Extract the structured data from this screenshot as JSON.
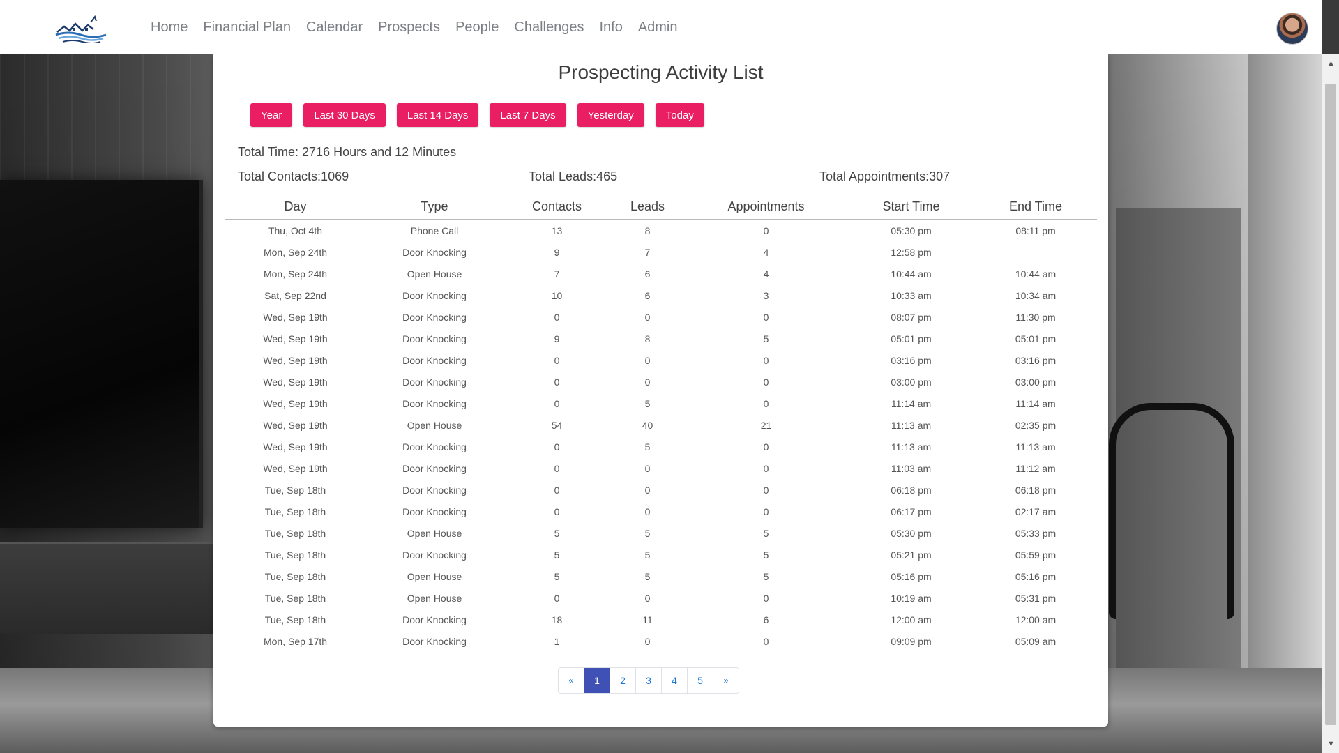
{
  "nav": {
    "links": [
      "Home",
      "Financial Plan",
      "Calendar",
      "Prospects",
      "People",
      "Challenges",
      "Info",
      "Admin"
    ]
  },
  "page": {
    "title": "Prospecting Activity List",
    "filters": [
      "Year",
      "Last 30 Days",
      "Last 14 Days",
      "Last 7 Days",
      "Yesterday",
      "Today"
    ],
    "total_time": "Total Time: 2716 Hours and 12 Minutes",
    "total_contacts": "Total Contacts:1069",
    "total_leads": "Total Leads:465",
    "total_appointments": "Total Appointments:307"
  },
  "table": {
    "columns": [
      "Day",
      "Type",
      "Contacts",
      "Leads",
      "Appointments",
      "Start Time",
      "End Time"
    ],
    "rows": [
      [
        "Thu, Oct 4th",
        "Phone Call",
        "13",
        "8",
        "0",
        "05:30 pm",
        "08:11 pm"
      ],
      [
        "Mon, Sep 24th",
        "Door Knocking",
        "9",
        "7",
        "4",
        "12:58 pm",
        ""
      ],
      [
        "Mon, Sep 24th",
        "Open House",
        "7",
        "6",
        "4",
        "10:44 am",
        "10:44 am"
      ],
      [
        "Sat, Sep 22nd",
        "Door Knocking",
        "10",
        "6",
        "3",
        "10:33 am",
        "10:34 am"
      ],
      [
        "Wed, Sep 19th",
        "Door Knocking",
        "0",
        "0",
        "0",
        "08:07 pm",
        "11:30 pm"
      ],
      [
        "Wed, Sep 19th",
        "Door Knocking",
        "9",
        "8",
        "5",
        "05:01 pm",
        "05:01 pm"
      ],
      [
        "Wed, Sep 19th",
        "Door Knocking",
        "0",
        "0",
        "0",
        "03:16 pm",
        "03:16 pm"
      ],
      [
        "Wed, Sep 19th",
        "Door Knocking",
        "0",
        "0",
        "0",
        "03:00 pm",
        "03:00 pm"
      ],
      [
        "Wed, Sep 19th",
        "Door Knocking",
        "0",
        "5",
        "0",
        "11:14 am",
        "11:14 am"
      ],
      [
        "Wed, Sep 19th",
        "Open House",
        "54",
        "40",
        "21",
        "11:13 am",
        "02:35 pm"
      ],
      [
        "Wed, Sep 19th",
        "Door Knocking",
        "0",
        "5",
        "0",
        "11:13 am",
        "11:13 am"
      ],
      [
        "Wed, Sep 19th",
        "Door Knocking",
        "0",
        "0",
        "0",
        "11:03 am",
        "11:12 am"
      ],
      [
        "Tue, Sep 18th",
        "Door Knocking",
        "0",
        "0",
        "0",
        "06:18 pm",
        "06:18 pm"
      ],
      [
        "Tue, Sep 18th",
        "Door Knocking",
        "0",
        "0",
        "0",
        "06:17 pm",
        "02:17 am"
      ],
      [
        "Tue, Sep 18th",
        "Open House",
        "5",
        "5",
        "5",
        "05:30 pm",
        "05:33 pm"
      ],
      [
        "Tue, Sep 18th",
        "Door Knocking",
        "5",
        "5",
        "5",
        "05:21 pm",
        "05:59 pm"
      ],
      [
        "Tue, Sep 18th",
        "Open House",
        "5",
        "5",
        "5",
        "05:16 pm",
        "05:16 pm"
      ],
      [
        "Tue, Sep 18th",
        "Open House",
        "0",
        "0",
        "0",
        "10:19 am",
        "05:31 pm"
      ],
      [
        "Tue, Sep 18th",
        "Door Knocking",
        "18",
        "11",
        "6",
        "12:00 am",
        "12:00 am"
      ],
      [
        "Mon, Sep 17th",
        "Door Knocking",
        "1",
        "0",
        "0",
        "09:09 pm",
        "05:09 am"
      ]
    ]
  },
  "pagination": {
    "prev": "«",
    "pages": [
      "1",
      "2",
      "3",
      "4",
      "5"
    ],
    "next": "»",
    "active": "1"
  },
  "icons": {
    "logo": "house-wave-logo",
    "avatar": "user-avatar",
    "scroll_up": "▲",
    "scroll_down": "▼"
  },
  "colors": {
    "accent": "#e91e63",
    "pagination_active": "#3f51b5",
    "link": "#1976d2"
  }
}
